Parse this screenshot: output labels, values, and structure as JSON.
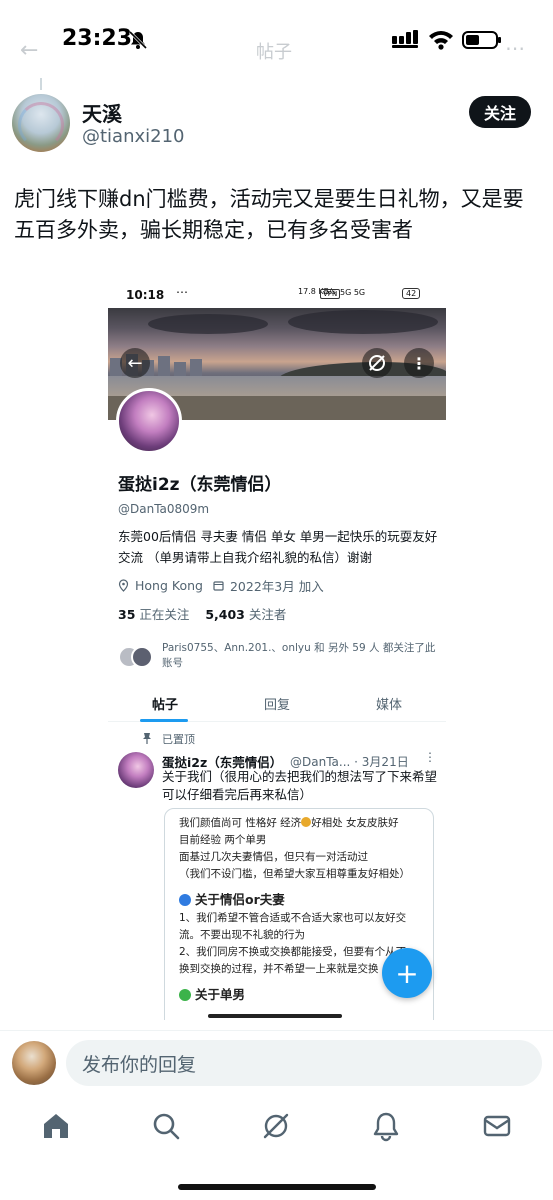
{
  "status_bar": {
    "time": "23:23",
    "battery_icon": "battery-icon",
    "signal_icon": "signal-icon",
    "wifi_icon": "wifi-icon",
    "mute_icon": "bell-slash-icon"
  },
  "header": {
    "title": "帖子"
  },
  "tweet": {
    "display_name": "天溪",
    "handle": "@tianxi210",
    "follow_label": "关注",
    "text": "虎门线下赚dn门槛费，活动完又是要生日礼物，又是要五百多外卖，骗长期稳定，已有多名受害者"
  },
  "embedded_screenshot": {
    "status": {
      "time": "10:18",
      "dots": "⋯",
      "net": "17.8 KB/s",
      "vpn": "VPN",
      "signal": "5G  5G",
      "battery": "42"
    },
    "profile": {
      "name": "蛋挞i2z（东莞情侣）",
      "handle": "@DanTa0809m",
      "bio": "东莞00后情侣 寻夫妻 情侣 单女 单男一起快乐的玩耍友好交流 （单男请带上自我介绍礼貌的私信）谢谢",
      "location": "Hong Kong",
      "joined": "2022年3月 加入",
      "following_count": "35",
      "following_label": "正在关注",
      "followers_count": "5,403",
      "followers_label": "关注者",
      "mutuals": "Paris0755、Ann.201.、onlyu 和 另外 59 人 都关注了此账号"
    },
    "tabs": [
      "帖子",
      "回复",
      "媒体"
    ],
    "pinned_label": "已置顶",
    "post": {
      "name": "蛋挞i2z（东莞情侣）",
      "handle": "@DanTa...",
      "time": "· 3月21日",
      "text": "关于我们（很用心的去把我们的想法写了下来希望可以仔细看完后再来私信）",
      "card": {
        "line1a": "我们颜值尚可 性格好 经济",
        "line1b": "好相处 女友皮肤好",
        "line2": "目前经验 两个单男",
        "line3": "面基过几次夫妻情侣，但只有一对活动过",
        "line4": "（我们不设门槛，但希望大家互相尊重友好相处）",
        "heading1": "关于情侣or夫妻",
        "p1": "1、我们希望不管合适或不合适大家也可以友好交",
        "p2": "流。不要出现不礼貌的行为",
        "p3": "2、我们同房不换或交换都能接受，但要有个从不",
        "p4": "换到交换的过程，并不希望一上来就是交换",
        "heading2": "关于单男"
      }
    },
    "fab_label": "+"
  },
  "reply": {
    "placeholder": "发布你的回复"
  },
  "nav": {
    "items": [
      "home-icon",
      "search-icon",
      "grok-icon",
      "bell-icon",
      "mail-icon"
    ]
  },
  "colors": {
    "accent": "#1d9bf0",
    "text": "#0f1419",
    "muted": "#536471"
  }
}
